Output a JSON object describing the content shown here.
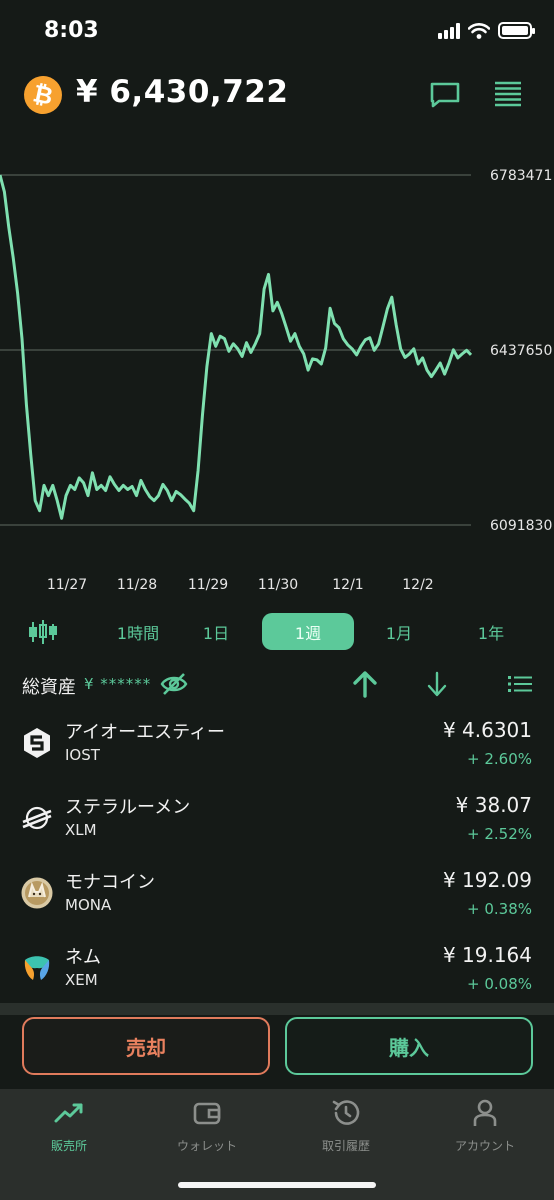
{
  "status_bar": {
    "time": "8:03"
  },
  "header": {
    "coin_symbol": "₿",
    "price": "¥ 6,430,722"
  },
  "chart_data": {
    "type": "line",
    "x_labels": [
      "11/27",
      "11/28",
      "11/29",
      "11/30",
      "12/1",
      "12/2"
    ],
    "y_ticks": [
      "6783471",
      "6437650",
      "6091830"
    ],
    "ylim": [
      6091830,
      6783471
    ],
    "color": "#7fe0b0",
    "values": [
      6783471,
      6750000,
      6680000,
      6620000,
      6550000,
      6460000,
      6330000,
      6230000,
      6140000,
      6120000,
      6170000,
      6150000,
      6170000,
      6140000,
      6105000,
      6150000,
      6170000,
      6162000,
      6185000,
      6175000,
      6150000,
      6195000,
      6162000,
      6170000,
      6160000,
      6187000,
      6172000,
      6160000,
      6170000,
      6162000,
      6168000,
      6150000,
      6180000,
      6162000,
      6148000,
      6140000,
      6150000,
      6172000,
      6160000,
      6140000,
      6158000,
      6152000,
      6143000,
      6135000,
      6120000,
      6200000,
      6310000,
      6405000,
      6470000,
      6445000,
      6465000,
      6460000,
      6435000,
      6450000,
      6440000,
      6425000,
      6452000,
      6433000,
      6450000,
      6470000,
      6558000,
      6587000,
      6515000,
      6532000,
      6510000,
      6483000,
      6455000,
      6470000,
      6445000,
      6430000,
      6398000,
      6420000,
      6418000,
      6410000,
      6442000,
      6520000,
      6490000,
      6482000,
      6460000,
      6448000,
      6440000,
      6428000,
      6445000,
      6458000,
      6462000,
      6437000,
      6450000,
      6484000,
      6519000,
      6542000,
      6487000,
      6440000,
      6423000,
      6430000,
      6440000,
      6410000,
      6422000,
      6398000,
      6385000,
      6398000,
      6412000,
      6390000,
      6412000,
      6438000,
      6422000,
      6430000,
      6437000,
      6428000
    ]
  },
  "periods": [
    {
      "label": "1時間",
      "active": false
    },
    {
      "label": "1日",
      "active": false
    },
    {
      "label": "1週",
      "active": true
    },
    {
      "label": "1月",
      "active": false
    },
    {
      "label": "1年",
      "active": false
    }
  ],
  "assets": {
    "label": "総資産",
    "masked_value": "¥ ******"
  },
  "coins": [
    {
      "name": "アイオーエスティー",
      "symbol": "IOST",
      "price": "¥ 4.6301",
      "change": "+ 2.60%"
    },
    {
      "name": "ステラルーメン",
      "symbol": "XLM",
      "price": "¥ 38.07",
      "change": "+ 2.52%"
    },
    {
      "name": "モナコイン",
      "symbol": "MONA",
      "price": "¥ 192.09",
      "change": "+ 0.38%"
    },
    {
      "name": "ネム",
      "symbol": "XEM",
      "price": "¥ 19.164",
      "change": "+ 0.08%"
    }
  ],
  "actions": {
    "sell": "売却",
    "buy": "購入"
  },
  "tabs": [
    {
      "label": "販売所",
      "icon": "trend-icon",
      "active": true
    },
    {
      "label": "ウォレット",
      "icon": "wallet-icon",
      "active": false
    },
    {
      "label": "取引履歴",
      "icon": "history-icon",
      "active": false
    },
    {
      "label": "アカウント",
      "icon": "account-icon",
      "active": false
    }
  ],
  "colors": {
    "accent": "#5cc99a",
    "sell": "#e07b5c",
    "background": "#151a17",
    "coin_btc": "#f7a12f"
  }
}
